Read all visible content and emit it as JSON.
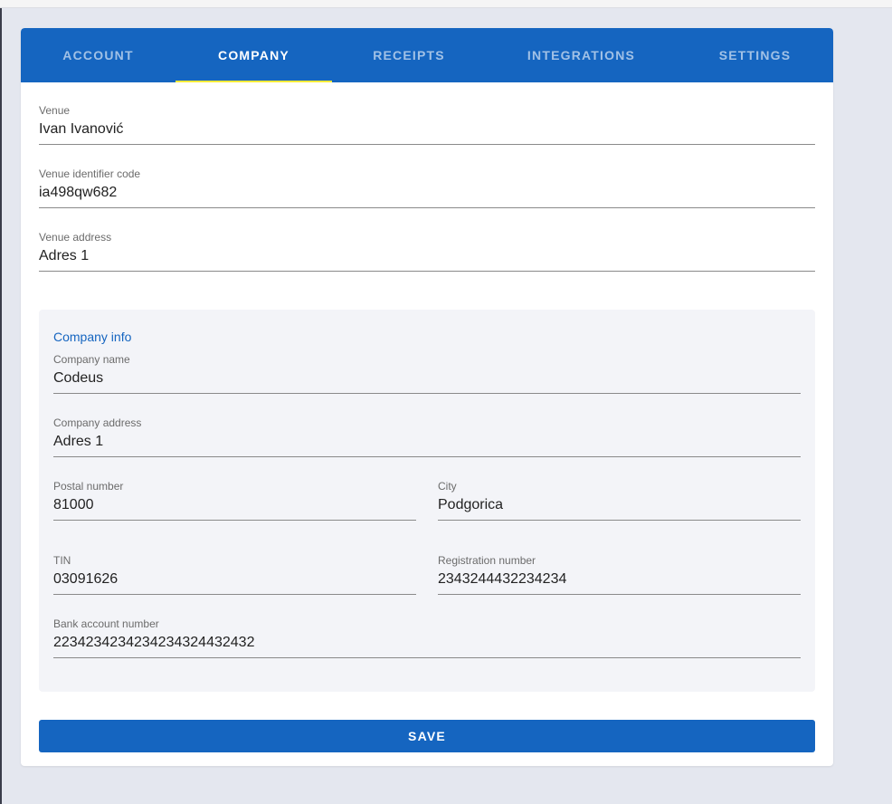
{
  "tabs": [
    {
      "label": "ACCOUNT",
      "active": false
    },
    {
      "label": "COMPANY",
      "active": true
    },
    {
      "label": "RECEIPTS",
      "active": false
    },
    {
      "label": "INTEGRATIONS",
      "active": false
    },
    {
      "label": "SETTINGS",
      "active": false
    }
  ],
  "venue": {
    "name_label": "Venue",
    "name_value": "Ivan Ivanović",
    "code_label": "Venue identifier code",
    "code_value": "ia498qw682",
    "address_label": "Venue address",
    "address_value": "Adres 1"
  },
  "company": {
    "section_title": "Company info",
    "name_label": "Company name",
    "name_value": "Codeus",
    "address_label": "Company address",
    "address_value": "Adres 1",
    "postal_label": "Postal number",
    "postal_value": "81000",
    "city_label": "City",
    "city_value": "Podgorica",
    "tin_label": "TIN",
    "tin_value": "03091626",
    "reg_label": "Registration number",
    "reg_value": "2343244432234234",
    "bank_label": "Bank account number",
    "bank_value": "223423423423423432443243 2"
  },
  "actions": {
    "save_label": "SAVE"
  },
  "colors": {
    "primary": "#1565c0",
    "tab_indicator": "#ffeb3b",
    "background": "#e4e7ef",
    "section_bg": "#f3f4f8"
  }
}
